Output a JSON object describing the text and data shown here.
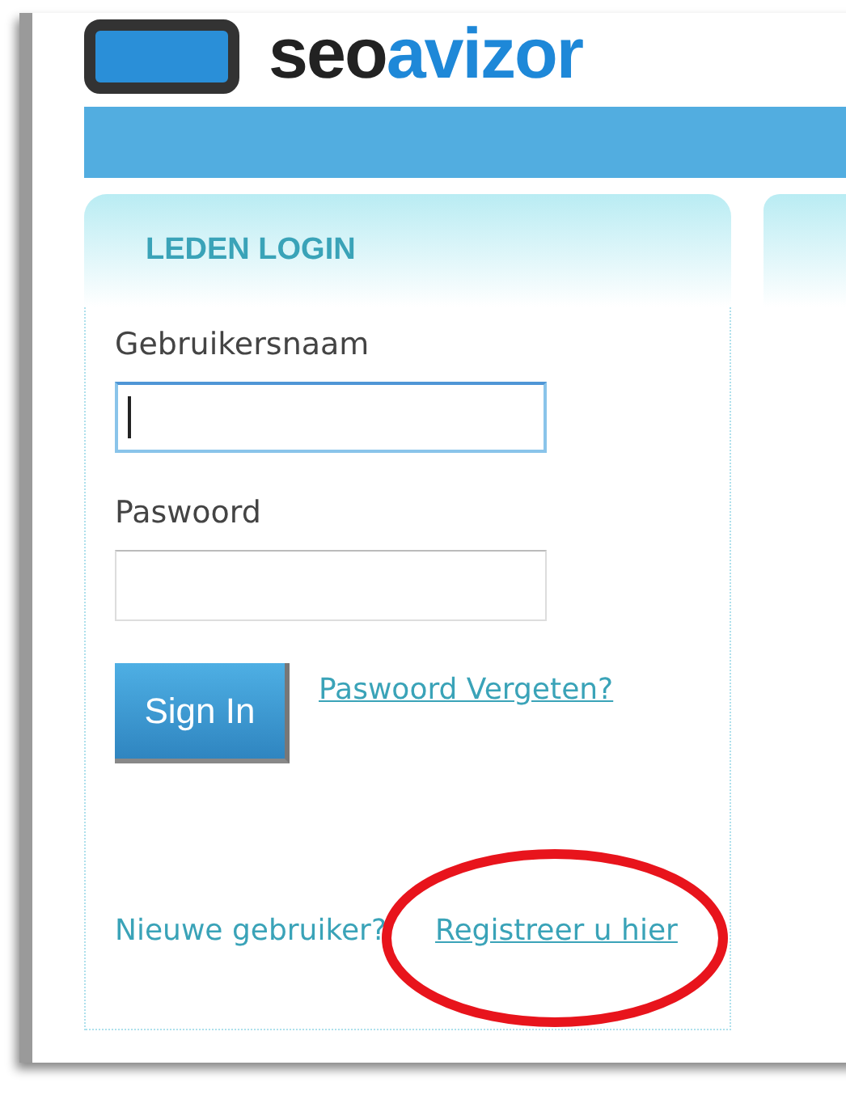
{
  "logo": {
    "text_dark": "seo",
    "text_accent": "avizor"
  },
  "login": {
    "title": "LEDEN LOGIN",
    "fields": [
      {
        "label": "Gebruikersnaam",
        "focused": true
      },
      {
        "label": "Paswoord",
        "focused": false
      }
    ],
    "sign_in": "Sign In",
    "forgot_link": "Paswoord Vergeten?",
    "new_user_text": "Nieuwe gebruiker?",
    "register_link": "Registreer u hier"
  }
}
